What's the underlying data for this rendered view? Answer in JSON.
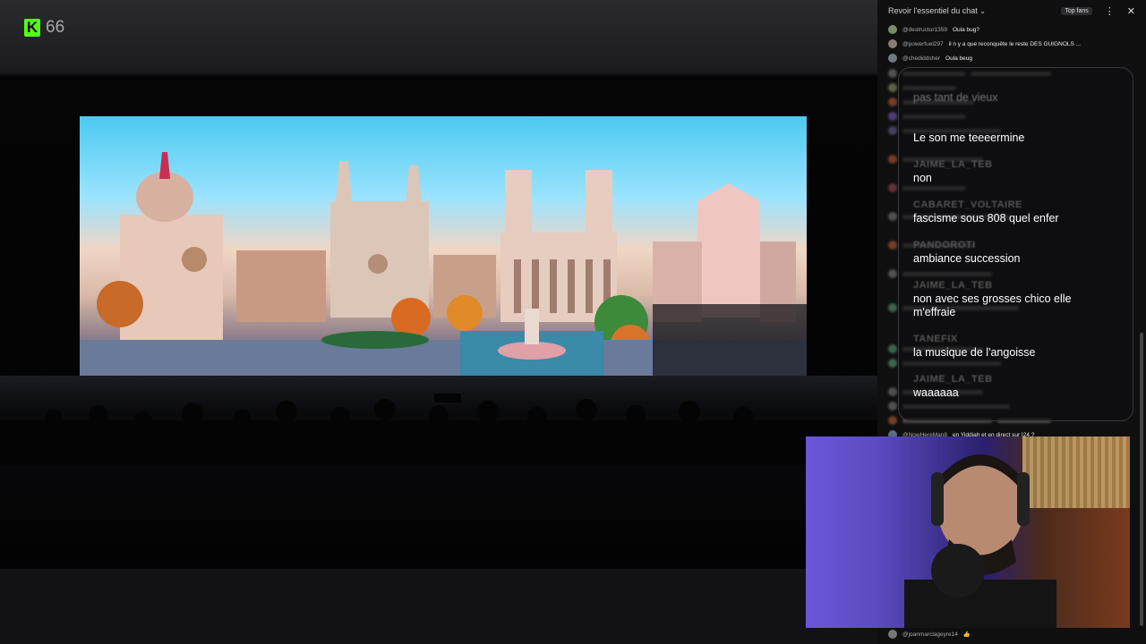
{
  "brand": {
    "logo_letter": "K",
    "viewer_count": "66",
    "accent": "#53fc18"
  },
  "chat": {
    "header": {
      "title": "Revoir l'essentiel du chat",
      "top_fans_label": "Top fans"
    },
    "messages": [
      {
        "user": "@destructor1359",
        "text": "Oula bug?",
        "avatar_color": "#7a8a6a"
      },
      {
        "user": "@powerfuel297",
        "text": "il n y a que reconquête le reste DES GUIGNOLS ...",
        "avatar_color": "#8a7b6d"
      },
      {
        "user": "@chediddsher",
        "text": "Oula beug",
        "avatar_color": "#6f7a80"
      }
    ],
    "bottom_messages": [
      {
        "user": "@NowHereMan8",
        "text": "en Yiddiah et en direct sur I24 ?",
        "avatar_color": "#5a6a8a"
      },
      {
        "user": "@joanmarclageyre14",
        "text": "👍",
        "avatar_color": "#777"
      }
    ],
    "overlay": [
      {
        "user": "",
        "text": "pas tant de vieux"
      },
      {
        "user": "",
        "text": "Le son me teeeermine"
      },
      {
        "user": "JAIME_LA_TEB",
        "text": "non"
      },
      {
        "user": "CABARET_VOLTAIRE",
        "text": "fascisme sous 808 quel enfer"
      },
      {
        "user": "PANDOROTI",
        "text": "ambiance succession"
      },
      {
        "user": "JAIME_LA_TEB",
        "text": "non avec ses grosses chico elle m'effraie"
      },
      {
        "user": "TANEFIX",
        "text": "la musique de l'angoisse"
      },
      {
        "user": "JAIME_LA_TEB",
        "text": "waaaaaa"
      }
    ]
  }
}
